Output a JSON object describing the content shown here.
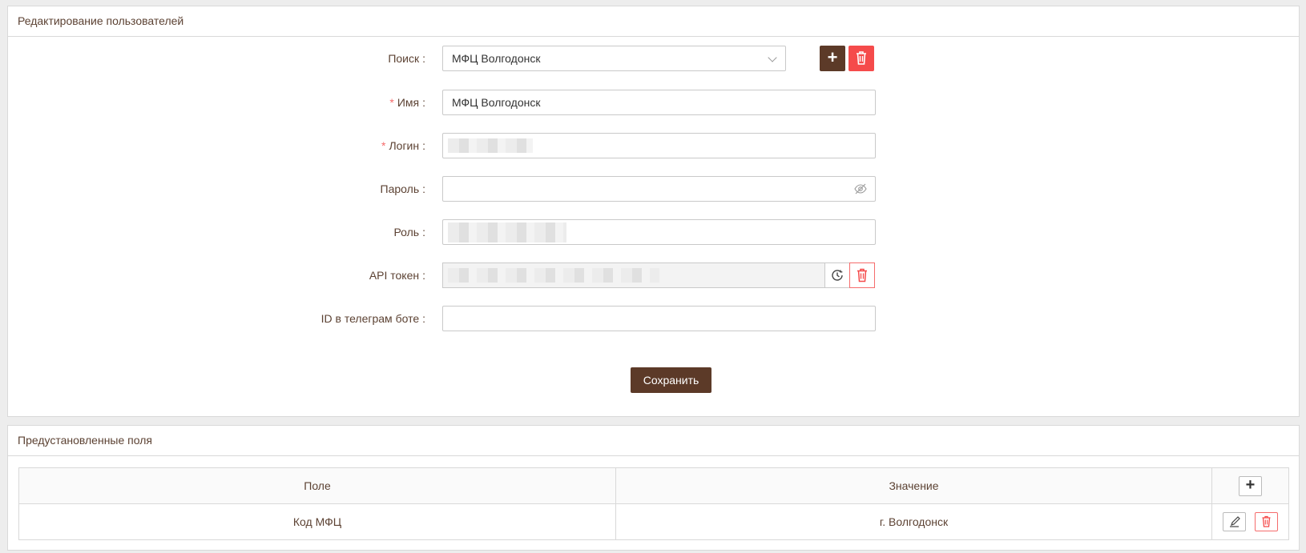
{
  "edit_card": {
    "title": "Редактирование пользователей",
    "search": {
      "label": "Поиск",
      "value": "МФЦ Волгодонск"
    },
    "name": {
      "label": "Имя",
      "value": "МФЦ Волгодонск"
    },
    "login": {
      "label": "Логин",
      "value": ""
    },
    "password": {
      "label": "Пароль",
      "value": ""
    },
    "role": {
      "label": "Роль",
      "value": ""
    },
    "api_token": {
      "label": "API токен",
      "value": ""
    },
    "telegram": {
      "label": "ID в телеграм боте",
      "value": ""
    },
    "save_label": "Сохранить",
    "colon": ":",
    "required_mark": "*",
    "add_icon": "+"
  },
  "preset_card": {
    "title": "Предустановленные поля",
    "columns": [
      "Поле",
      "Значение"
    ],
    "rows": [
      {
        "field": "Код МФЦ",
        "value": "г. Волгодонск"
      }
    ]
  },
  "icons": {
    "add": "plus-icon",
    "delete": "trash-icon",
    "eye": "eye-off-icon",
    "regenerate": "clock-icon",
    "edit": "pencil-icon"
  },
  "colors": {
    "brand": "#5c3a28",
    "danger": "#f54b4b",
    "label": "#5c4233"
  }
}
